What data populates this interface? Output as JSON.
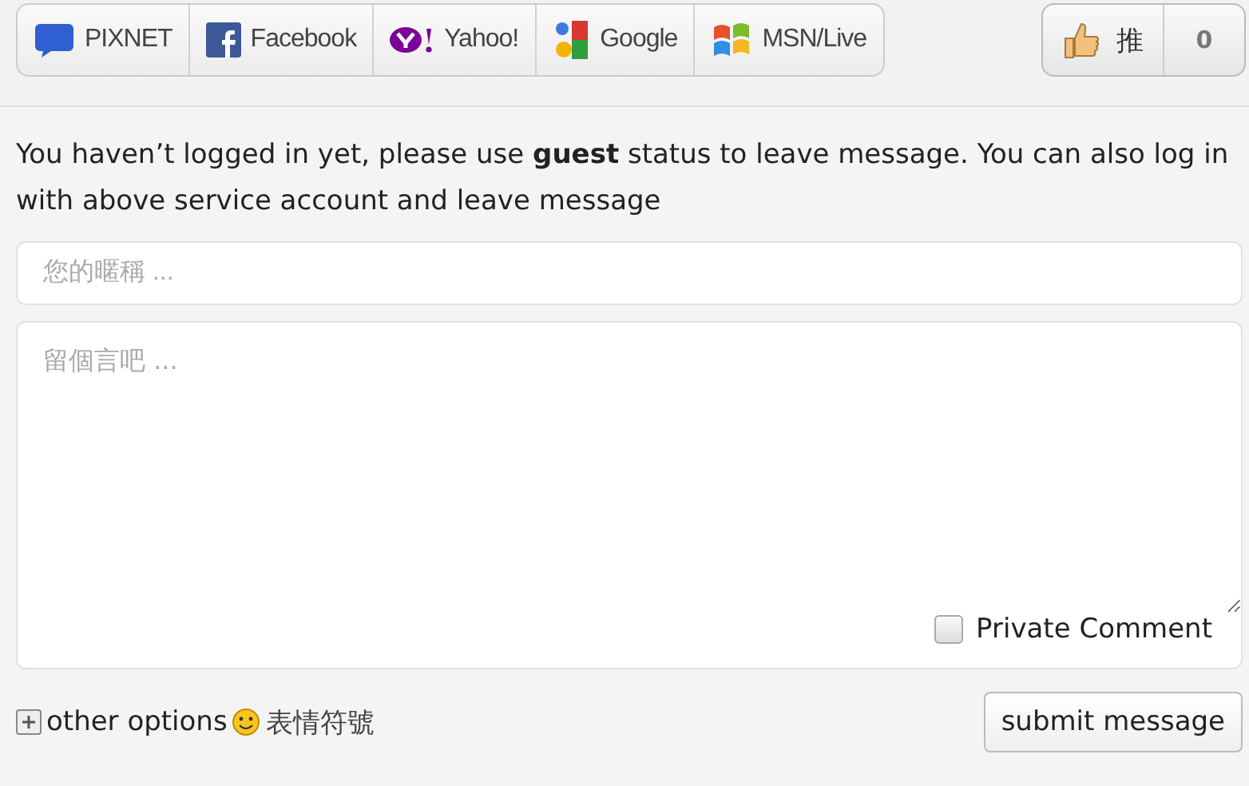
{
  "login_services": [
    {
      "kind": "pixnet",
      "label": "PIXNET"
    },
    {
      "kind": "facebook",
      "label": "Facebook"
    },
    {
      "kind": "yahoo",
      "label": "Yahoo!"
    },
    {
      "kind": "google",
      "label": "Google"
    },
    {
      "kind": "msn",
      "label": "MSN/Live"
    }
  ],
  "like": {
    "label": "推",
    "count": "0"
  },
  "notice": "You haven’t logged in yet, please use **guest** status to leave message. You can also log in with above service account and leave message",
  "nickname": {
    "placeholder": "您的暱稱 ..."
  },
  "message": {
    "placeholder": "留個言吧 ..."
  },
  "private_comment": {
    "label": "Private Comment",
    "checked": false
  },
  "other_options": {
    "label": "other options",
    "expanded": false
  },
  "emoticons": {
    "label": "表情符號"
  },
  "submit": {
    "label": "submit message"
  }
}
